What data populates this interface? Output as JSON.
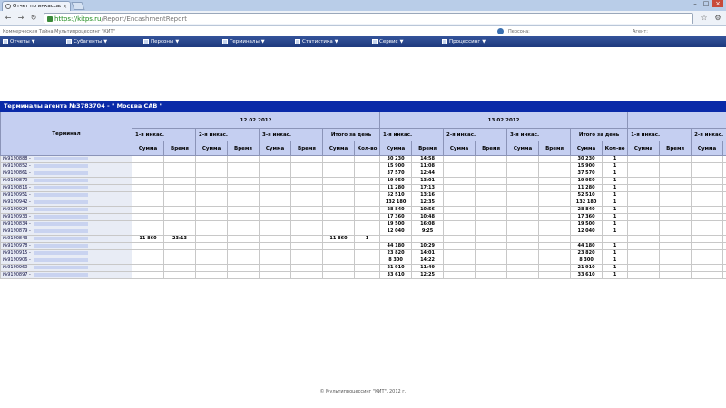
{
  "browser": {
    "tab_title": "Отчет по инкассациям авто",
    "tab_close": "×",
    "url_host": "https://kitps.ru",
    "url_path": "/Report/EncashmentReport",
    "back_icon": "back-arrow-icon",
    "forward_icon": "forward-arrow-icon",
    "reload_icon": "reload-icon"
  },
  "userbar": {
    "company": "Коммерческая Тайна Мультипроцессинг \"КИТ\"",
    "persona_label": "Персона:",
    "agent_label": "Агент:"
  },
  "menu": [
    {
      "label": "Отчеты"
    },
    {
      "label": "Субагенты"
    },
    {
      "label": "Персоны"
    },
    {
      "label": "Терминалы"
    },
    {
      "label": "Статистика"
    },
    {
      "label": "Сервис"
    },
    {
      "label": "Процессинг"
    }
  ],
  "banner": "Терминалы агента №3783704 - \" Москва САВ \"",
  "table": {
    "terminal_header": "Терминал",
    "dates": [
      "12.02.2012",
      "13.02.2012",
      "1"
    ],
    "group_labels": [
      "1-я инкас.",
      "2-я инкас.",
      "3-я инкас.",
      "Итого за день"
    ],
    "sub_sum": "Сумма",
    "sub_time": "Время",
    "sub_count": "Кол-во",
    "rows": [
      {
        "id": "№9190888 -",
        "d2": [
          "30 230",
          "14:58",
          "30 230",
          "1"
        ]
      },
      {
        "id": "№9190852 -",
        "d2": [
          "15 900",
          "11:08",
          "15 900",
          "1"
        ]
      },
      {
        "id": "№9190861 -",
        "d2": [
          "37 570",
          "12:44",
          "37 570",
          "1"
        ]
      },
      {
        "id": "№9190870 -",
        "d2": [
          "19 950",
          "13:01",
          "19 950",
          "1"
        ]
      },
      {
        "id": "№9190816 -",
        "d2": [
          "11 280",
          "17:13",
          "11 280",
          "1"
        ]
      },
      {
        "id": "№9190951 -",
        "d2": [
          "52 510",
          "13:16",
          "52 510",
          "1"
        ]
      },
      {
        "id": "№9190942 -",
        "d2": [
          "132 180",
          "12:35",
          "132 180",
          "1"
        ]
      },
      {
        "id": "№9190924 -",
        "d2": [
          "28 840",
          "10:56",
          "28 840",
          "1"
        ]
      },
      {
        "id": "№9190933 -",
        "d2": [
          "17 360",
          "10:48",
          "17 360",
          "1"
        ]
      },
      {
        "id": "№9190834 -",
        "d2": [
          "19 500",
          "16:08",
          "19 500",
          "1"
        ]
      },
      {
        "id": "№9190879 -",
        "d2": [
          "12 040",
          "9:25",
          "12 040",
          "1"
        ]
      },
      {
        "id": "№9190843 -",
        "d1": [
          "11 860",
          "23:13",
          "11 860",
          "1"
        ]
      },
      {
        "id": "№9190978 -",
        "d2": [
          "44 180",
          "10:29",
          "44 180",
          "1"
        ]
      },
      {
        "id": "№9190915 -",
        "d2": [
          "23 820",
          "14:01",
          "23 820",
          "1"
        ]
      },
      {
        "id": "№9190906 -",
        "d2": [
          "8 300",
          "14:22",
          "8 300",
          "1"
        ]
      },
      {
        "id": "№9190960 -",
        "d2": [
          "21 910",
          "11:49",
          "21 910",
          "1"
        ]
      },
      {
        "id": "№9190897 -",
        "d2": [
          "33 610",
          "12:25",
          "33 610",
          "1"
        ]
      }
    ]
  },
  "footer": "© Мультипроцессинг \"КИТ\", 2012 г."
}
